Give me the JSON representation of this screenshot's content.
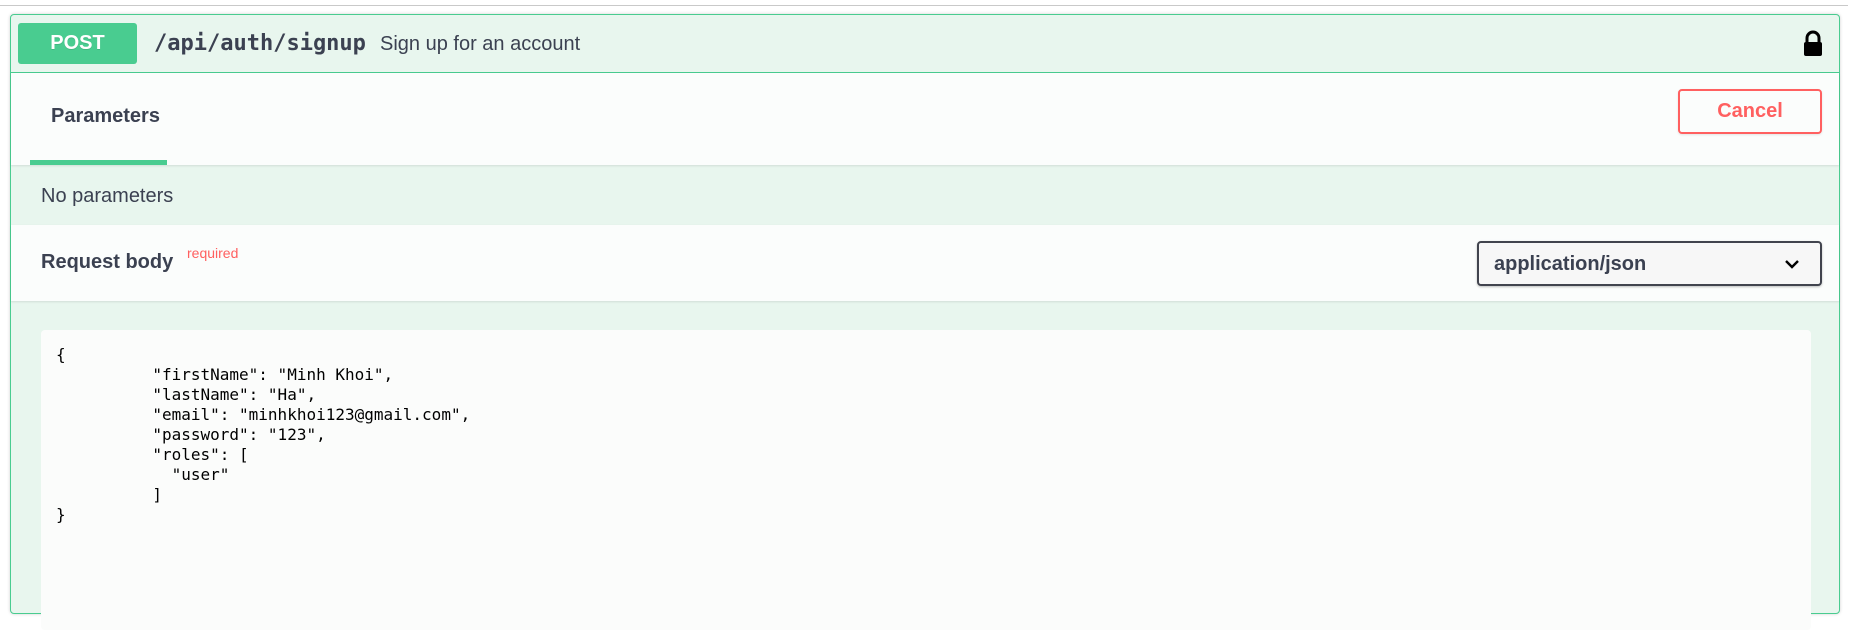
{
  "operation": {
    "method": "POST",
    "path": "/api/auth/signup",
    "description": "Sign up for an account",
    "lock_icon": "lock-icon"
  },
  "parameters": {
    "tab_label": "Parameters",
    "cancel_label": "Cancel",
    "empty_text": "No parameters"
  },
  "request_body": {
    "title": "Request body",
    "required_label": "required",
    "content_type": "application/json",
    "editor_text": "{\n          \"firstName\": \"Minh Khoi\",\n          \"lastName\": \"Ha\",\n          \"email\": \"minhkhoi123@gmail.com\",\n          \"password\": \"123\",\n          \"roles\": [\n            \"user\"\n          ]\n}"
  },
  "colors": {
    "post_green": "#49cc90",
    "post_bg": "#e8f6ee",
    "cancel_red": "#ff6060",
    "text": "#3b4151"
  }
}
